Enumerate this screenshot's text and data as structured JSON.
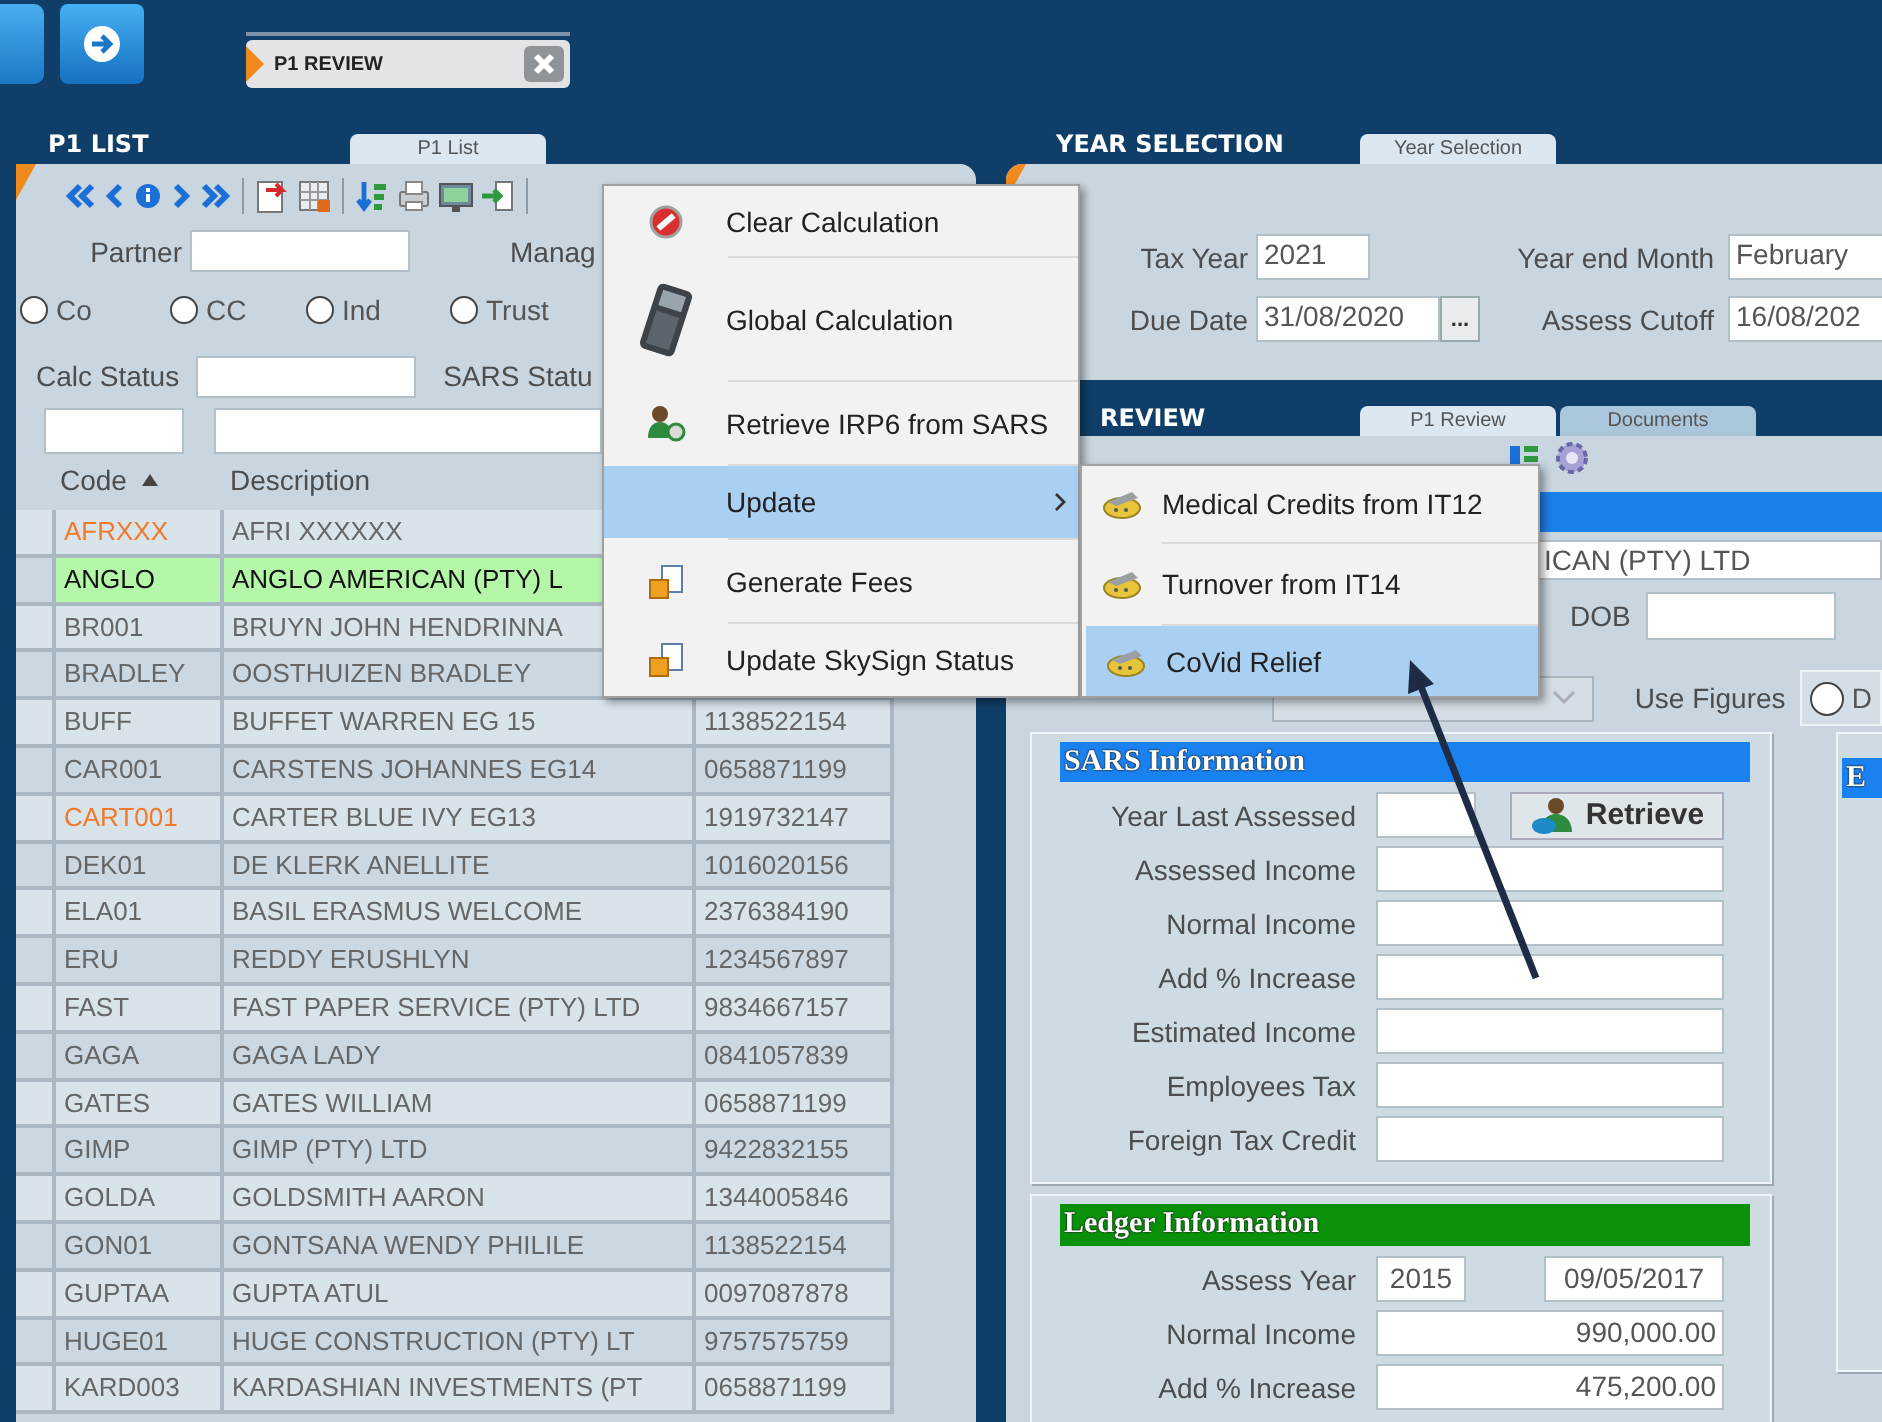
{
  "top_bar": {
    "document_tab": {
      "title": "P1 REVIEW"
    }
  },
  "p1_list": {
    "title": "P1 LIST",
    "tab": {
      "label": "P1 List",
      "selected": true
    },
    "partner_label": "Partner",
    "manager_label": "Manag",
    "entity_types": [
      {
        "label": "Co",
        "selected": false
      },
      {
        "label": "CC",
        "selected": false
      },
      {
        "label": "Ind",
        "selected": false
      },
      {
        "label": "Trust",
        "selected": false
      }
    ],
    "calc_status_label": "Calc Status",
    "sars_status_label": "SARS Statu",
    "columns": [
      {
        "label": "Code",
        "sorted": true
      },
      {
        "label": "Description",
        "sorted": false
      }
    ],
    "rows": [
      {
        "code": "AFRXXX",
        "description": "AFRI XXXXXX",
        "selected": false,
        "flagged": true
      },
      {
        "code": "ANGLO",
        "description": "ANGLO AMERICAN (PTY) L",
        "selected": true,
        "flagged": false
      },
      {
        "code": "BR001",
        "description": "BRUYN JOHN HENDRINNA",
        "selected": false,
        "flagged": false
      },
      {
        "code": "BRADLEY",
        "description": "OOSTHUIZEN BRADLEY",
        "selected": false,
        "flagged": false
      },
      {
        "code": "BUFF",
        "description": "BUFFET WARREN EG 15",
        "number": "1138522154",
        "selected": false,
        "flagged": false
      },
      {
        "code": "CAR001",
        "description": "CARSTENS JOHANNES EG14",
        "number": "0658871199",
        "selected": false,
        "flagged": false
      },
      {
        "code": "CART001",
        "description": "CARTER BLUE IVY EG13",
        "number": "1919732147",
        "selected": false,
        "flagged": true
      },
      {
        "code": "DEK01",
        "description": "DE KLERK ANELLITE",
        "number": "1016020156",
        "selected": false,
        "flagged": false
      },
      {
        "code": "ELA01",
        "description": "BASIL ERASMUS WELCOME",
        "number": "2376384190",
        "selected": false,
        "flagged": false
      },
      {
        "code": "ERU",
        "description": "REDDY ERUSHLYN",
        "number": "1234567897",
        "selected": false,
        "flagged": false
      },
      {
        "code": "FAST",
        "description": "FAST PAPER SERVICE (PTY) LTD",
        "number": "9834667157",
        "selected": false,
        "flagged": false
      },
      {
        "code": "GAGA",
        "description": "GAGA LADY",
        "number": "0841057839",
        "selected": false,
        "flagged": false
      },
      {
        "code": "GATES",
        "description": "GATES WILLIAM",
        "number": "0658871199",
        "selected": false,
        "flagged": false
      },
      {
        "code": "GIMP",
        "description": "GIMP (PTY) LTD",
        "number": "9422832155",
        "selected": false,
        "flagged": false
      },
      {
        "code": "GOLDA",
        "description": "GOLDSMITH AARON",
        "number": "1344005846",
        "selected": false,
        "flagged": false
      },
      {
        "code": "GON01",
        "description": "GONTSANA WENDY PHILILE",
        "number": "1138522154",
        "selected": false,
        "flagged": false
      },
      {
        "code": "GUPTAA",
        "description": "GUPTA ATUL",
        "number": "0097087878",
        "selected": false,
        "flagged": false
      },
      {
        "code": "HUGE01",
        "description": "HUGE CONSTRUCTION (PTY) LT",
        "number": "9757575759",
        "selected": false,
        "flagged": false
      },
      {
        "code": "KARD003",
        "description": "KARDASHIAN INVESTMENTS (PT",
        "number": "0658871199",
        "selected": false,
        "flagged": false
      }
    ]
  },
  "year_selection": {
    "title": "YEAR SELECTION",
    "tab": {
      "label": "Year Selection",
      "selected": true
    },
    "tax_year": {
      "label": "Tax Year",
      "value": "2021"
    },
    "year_end_month": {
      "label": "Year end Month",
      "value": "February"
    },
    "due_date": {
      "label": "Due Date",
      "value": "31/08/2020",
      "picker": "..."
    },
    "assess_cutoff": {
      "label": "Assess Cutoff",
      "value": "16/08/202"
    }
  },
  "review": {
    "title": "REVIEW",
    "tabs": [
      {
        "label": "P1 Review",
        "selected": true
      },
      {
        "label": "Documents",
        "selected": false
      }
    ],
    "client_name": "ICAN (PTY) LTD",
    "dob_label": "DOB",
    "use_figures": {
      "label": "Use Figures",
      "options": [
        {
          "label": "D",
          "selected": false
        }
      ]
    },
    "sars_information": {
      "title": "SARS Information",
      "year_last_assessed": {
        "label": "Year Last Assessed"
      },
      "retrieve_button": "Retrieve",
      "fields": [
        {
          "label": "Assessed Income"
        },
        {
          "label": "Normal Income"
        },
        {
          "label": "Add % Increase"
        },
        {
          "label": "Estimated Income"
        },
        {
          "label": "Employees Tax"
        },
        {
          "label": "Foreign Tax Credit"
        }
      ]
    },
    "ledger_information": {
      "title": "Ledger Information",
      "assess_year": {
        "label": "Assess Year",
        "value": "2015",
        "date": "09/05/2017"
      },
      "fields": [
        {
          "label": "Normal Income",
          "value": "990,000.00"
        },
        {
          "label": "Add % Increase",
          "value": "475,200.00"
        }
      ]
    },
    "side_panel_title": "E"
  },
  "context_menu": {
    "items": [
      {
        "label": "Clear Calculation",
        "selected": false,
        "has_submenu": false
      },
      {
        "label": "Global Calculation",
        "selected": false,
        "has_submenu": false
      },
      {
        "label": "Retrieve IRP6 from SARS",
        "selected": false,
        "has_submenu": false
      },
      {
        "label": "Update",
        "selected": true,
        "has_submenu": true
      },
      {
        "label": "Generate Fees",
        "selected": false,
        "has_submenu": false
      },
      {
        "label": "Update SkySign Status",
        "selected": false,
        "has_submenu": false
      }
    ],
    "submenu": [
      {
        "label": "Medical Credits from IT12",
        "selected": false
      },
      {
        "label": "Turnover from IT14",
        "selected": false
      },
      {
        "label": "CoVid Relief",
        "selected": true
      }
    ]
  }
}
